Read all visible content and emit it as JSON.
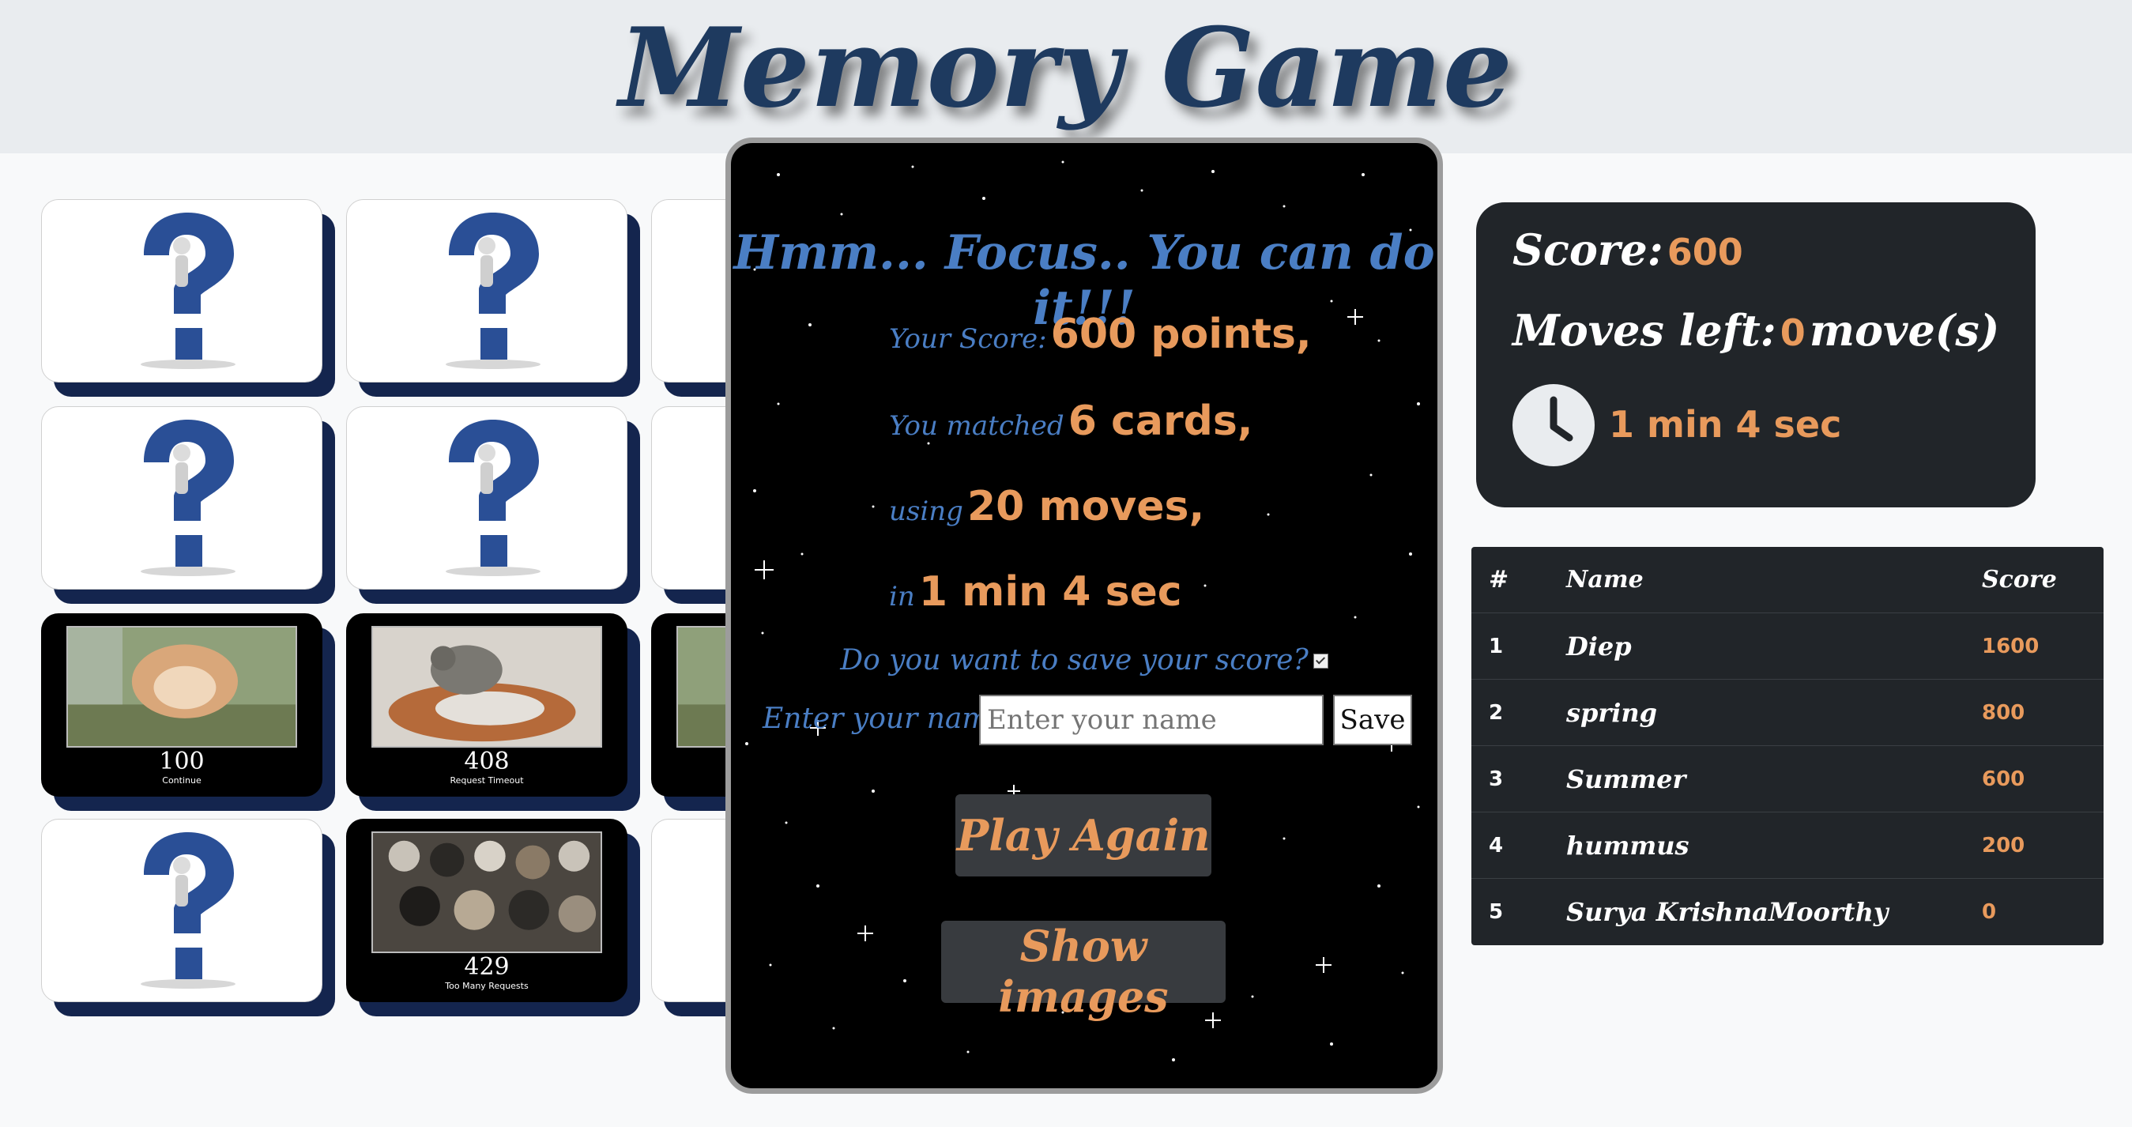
{
  "app": {
    "title": "Memory Game"
  },
  "board": {
    "cards": [
      {
        "state": "hidden",
        "icon": "question-mark-icon"
      },
      {
        "state": "hidden",
        "icon": "question-mark-icon"
      },
      {
        "state": "hidden",
        "icon": "question-mark-icon"
      },
      {
        "state": "hidden",
        "icon": "question-mark-icon"
      },
      {
        "state": "hidden",
        "icon": "question-mark-icon"
      },
      {
        "state": "hidden",
        "icon": "question-mark-icon"
      },
      {
        "state": "revealed",
        "code": "100",
        "caption": "Continue",
        "image": "cat-photo"
      },
      {
        "state": "revealed",
        "code": "408",
        "caption": "Request Timeout",
        "image": "cat-photo"
      },
      {
        "state": "revealed",
        "code": "",
        "caption": "",
        "image": "cat-photo"
      },
      {
        "state": "hidden",
        "icon": "question-mark-icon"
      },
      {
        "state": "revealed",
        "code": "429",
        "caption": "Too Many Requests",
        "image": "cat-photo"
      },
      {
        "state": "hidden",
        "icon": "question-mark-icon"
      }
    ]
  },
  "modal": {
    "heading": "Hmm... Focus.. You can do it!!!",
    "score_prefix": "Your Score:",
    "score_value": "600 points,",
    "matched_prefix": "You matched",
    "matched_value": "6 cards,",
    "moves_prefix": "using",
    "moves_value": "20 moves,",
    "time_prefix": "in",
    "time_value": "1 min 4 sec",
    "save_question": "Do you want to save your score?",
    "save_checked": true,
    "name_label": "Enter your name:",
    "name_placeholder": "Enter your name",
    "name_value": "",
    "save_label": "Save",
    "play_again_label": "Play Again",
    "show_images_label": "Show images"
  },
  "score_panel": {
    "score_label": "Score:",
    "score_value": "600",
    "moves_label": "Moves left:",
    "moves_value": "0",
    "moves_suffix": "move(s)",
    "time_value": "1 min 4 sec",
    "clock_icon": "clock-icon"
  },
  "leaderboard": {
    "headers": {
      "rank": "#",
      "name": "Name",
      "score": "Score"
    },
    "rows": [
      {
        "rank": "1",
        "name": "Diep",
        "score": "1600"
      },
      {
        "rank": "2",
        "name": "spring",
        "score": "800"
      },
      {
        "rank": "3",
        "name": "Summer",
        "score": "600"
      },
      {
        "rank": "4",
        "name": "hummus",
        "score": "200"
      },
      {
        "rank": "5",
        "name": "Surya KrishnaMoorthy",
        "score": "0"
      }
    ]
  },
  "colors": {
    "accent": "#e89a5c",
    "modal_text": "#4a7ec4",
    "title": "#1e3a5f",
    "panel_bg": "#212529",
    "card_shadow": "#14254e"
  }
}
